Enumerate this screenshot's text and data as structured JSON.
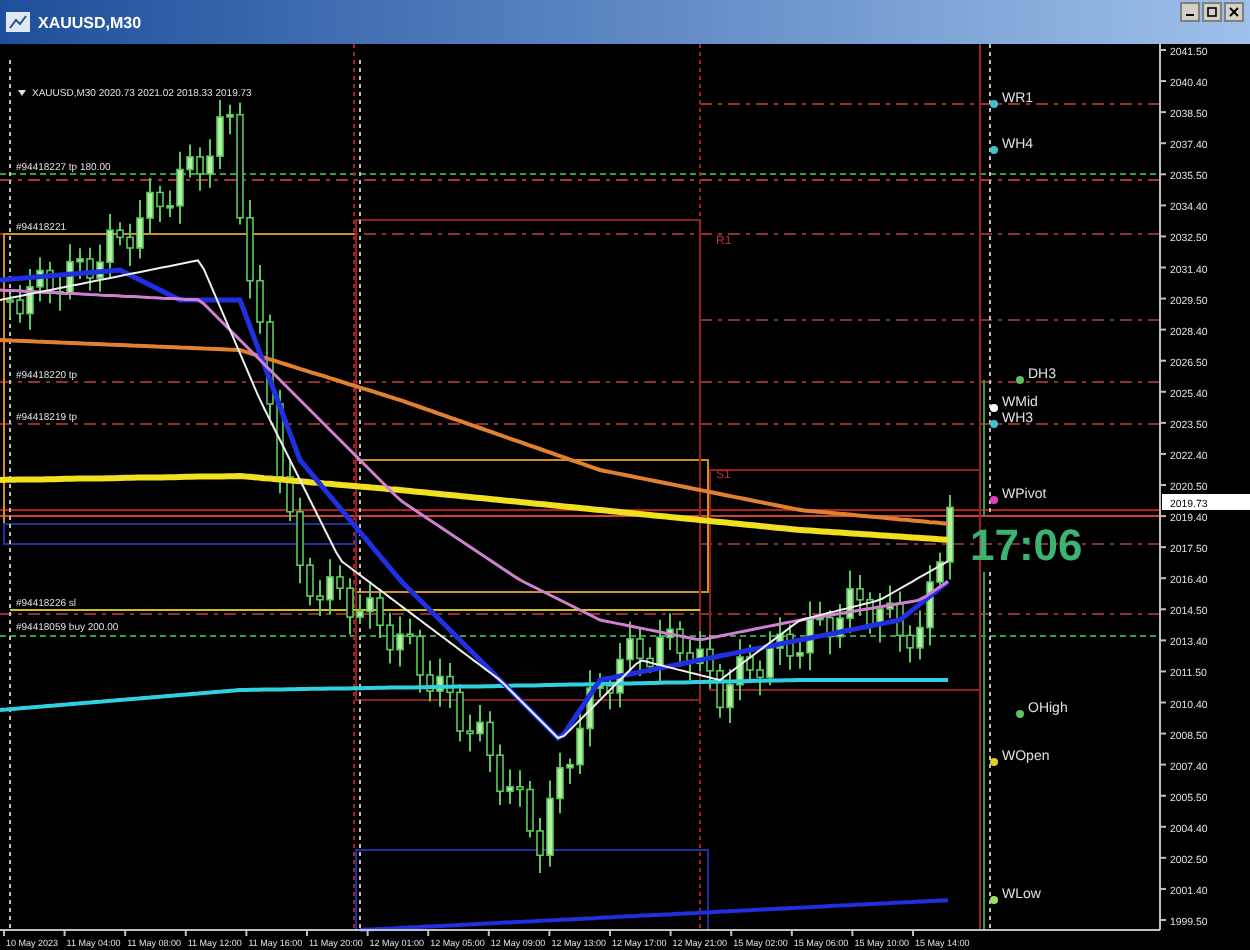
{
  "window": {
    "title": "XAUUSD,M30"
  },
  "chart": {
    "info": "XAUUSD,M30  2020.73 2021.02 2018.33 2019.73",
    "price_axis": {
      "labels": [
        "2041.50",
        "2040.40",
        "2038.50",
        "2037.40",
        "2035.50",
        "2034.40",
        "2032.50",
        "2031.40",
        "2029.50",
        "2028.40",
        "2026.50",
        "2025.40",
        "2023.50",
        "2022.40",
        "2020.50",
        "2019.40",
        "2017.50",
        "2016.40",
        "2014.50",
        "2013.40",
        "2011.50",
        "2010.40",
        "2008.50",
        "2007.40",
        "2005.50",
        "2004.40",
        "2002.50",
        "2001.40",
        "1999.50"
      ],
      "current": "2019.73"
    },
    "time_axis": [
      "10 May 2023",
      "11 May 04:00",
      "11 May 08:00",
      "11 May 12:00",
      "11 May 16:00",
      "11 May 20:00",
      "12 May 01:00",
      "12 May 05:00",
      "12 May 09:00",
      "12 May 13:00",
      "12 May 17:00",
      "12 May 21:00",
      "15 May 02:00",
      "15 May 06:00",
      "15 May 10:00",
      "15 May 14:00"
    ],
    "order_labels": [
      "#94418227 tp 180.00",
      "#94418221",
      "#94418220 tp",
      "#94418219 tp",
      "#94418226 sl",
      "#94418059 buy 200.00"
    ],
    "pivot_labels": [
      "R1",
      "S1"
    ],
    "level_labels": [
      {
        "text": "WR1",
        "color": "#40c0d0"
      },
      {
        "text": "WH4",
        "color": "#40c0d0"
      },
      {
        "text": "DH3",
        "color": "#60c060"
      },
      {
        "text": "WMid",
        "color": "#ffffff"
      },
      {
        "text": "WH3",
        "color": "#40c0d0"
      },
      {
        "text": "WPivot",
        "color": "#e040c0"
      },
      {
        "text": "OHigh",
        "color": "#60c060"
      },
      {
        "text": "WOpen",
        "color": "#e0d020"
      },
      {
        "text": "WLow",
        "color": "#a0e060"
      }
    ],
    "countdown": "17:06"
  }
}
